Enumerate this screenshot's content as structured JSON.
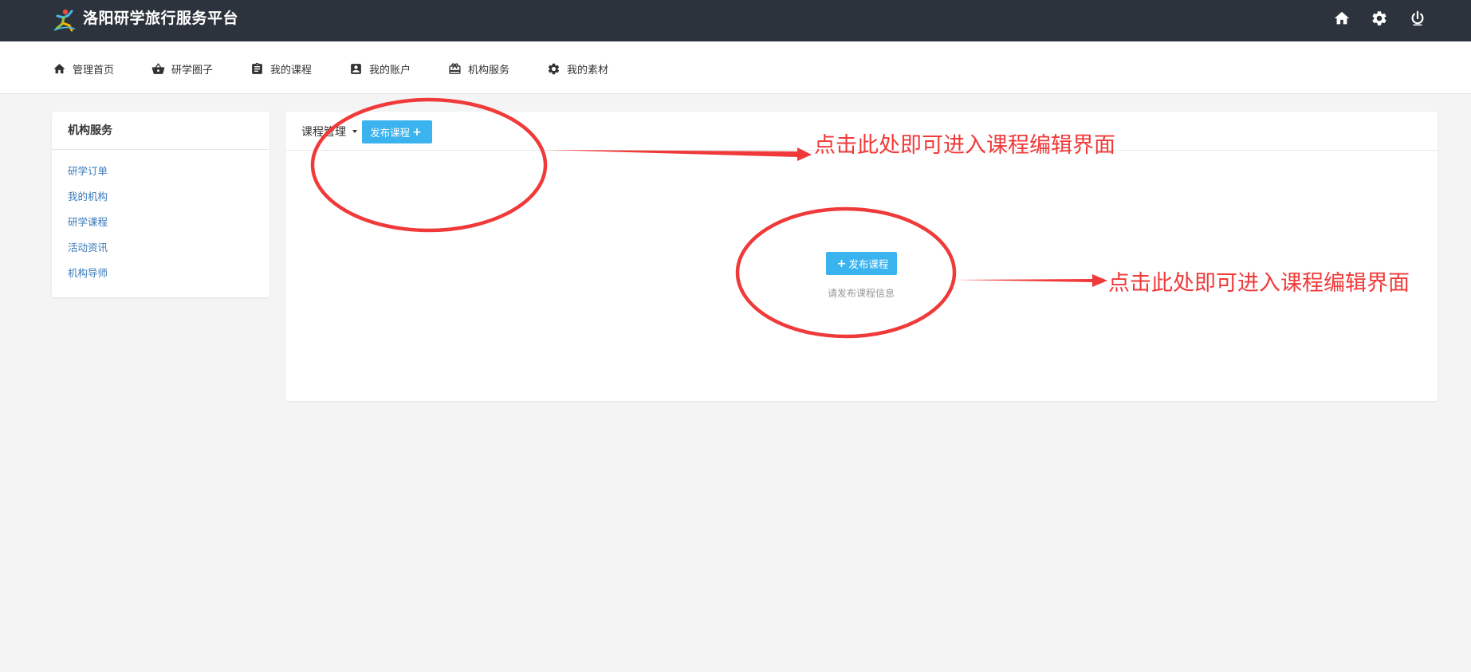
{
  "header": {
    "brand_title": "洛阳研学旅行服务平台",
    "logo_icon": "runner-logo-icon",
    "icons": [
      "home-icon",
      "gear-icon",
      "power-icon"
    ]
  },
  "nav": {
    "items": [
      {
        "label": "管理首页",
        "icon": "home-icon"
      },
      {
        "label": "研学圈子",
        "icon": "basket-icon"
      },
      {
        "label": "我的课程",
        "icon": "clipboard-icon"
      },
      {
        "label": "我的账户",
        "icon": "account-box-icon"
      },
      {
        "label": "机构服务",
        "icon": "store-icon"
      },
      {
        "label": "我的素材",
        "icon": "gear-icon"
      }
    ]
  },
  "sidebar": {
    "title": "机构服务",
    "links": [
      "研学订单",
      "我的机构",
      "研学课程",
      "活动资讯",
      "机构导师"
    ]
  },
  "main": {
    "title": "课程管理",
    "publish_top_label": "发布课程",
    "publish_center_label": "发布课程",
    "empty_hint": "请发布课程信息"
  },
  "annotations": {
    "note_top": "点击此处即可进入课程编辑界面",
    "note_center": "点击此处即可进入课程编辑界面",
    "color": "#f03a3a"
  },
  "colors": {
    "topbar": "#2d333c",
    "accent": "#3ab3ef",
    "link": "#3a7ab8",
    "background": "#f4f4f4"
  }
}
